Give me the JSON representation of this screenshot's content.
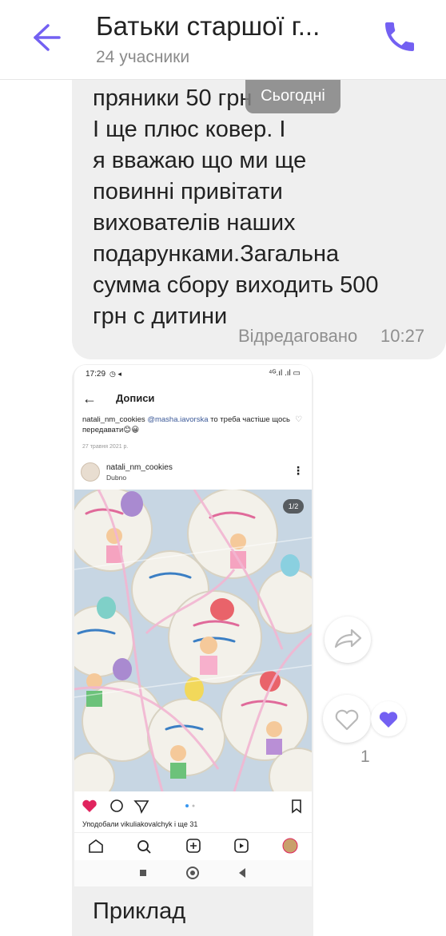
{
  "header": {
    "title": "Батьки старшої г...",
    "subtitle": "24 учасники",
    "back_icon": "back-arrow-icon",
    "call_icon": "phone-icon",
    "accent": "#7360f2"
  },
  "date_pill": "Сьогодні",
  "message": {
    "text": "пряники 50 грн\nІ ще плюс ковер.  І\nя вважаю що ми ще\nповинні привітати\nвихователів наших\nподарунками.Загальна\nсумма сбору виходить 500\nгрн с дитини",
    "edited_label": "Відредаговано",
    "time": "10:27"
  },
  "screenshot": {
    "status_time": "17:29",
    "status_icons": "◷ ◂",
    "status_right": "⁴ᴳ.ıl .ıl ▭",
    "top_title": "Дописи",
    "comment_user": "natali_nm_cookies",
    "comment_mention": "@masha.iavorska",
    "comment_text": "то треба частіше щось передавати😊😀",
    "comment_date": "27 травня 2021 р.",
    "post_user": "natali_nm_cookies",
    "post_location": "Dubno",
    "photo_counter": "1/2",
    "likes_text": "Уподобали vikuliakovalchyk і ще 31"
  },
  "caption": "Приклад",
  "reactions": {
    "count": "1",
    "heart_color": "#7360f2"
  }
}
